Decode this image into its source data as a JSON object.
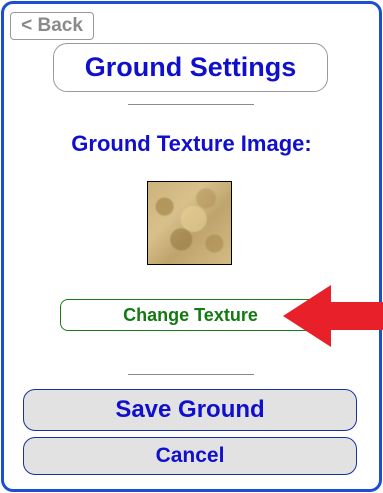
{
  "header": {
    "back_label": "< Back",
    "title": "Ground Settings"
  },
  "texture": {
    "label": "Ground Texture Image:",
    "preview_icon": "sand-texture-image",
    "change_label": "Change Texture"
  },
  "annotation": {
    "arrow_icon": "red-arrow-left-icon",
    "arrow_color": "#e8202a"
  },
  "footer": {
    "save_label": "Save Ground",
    "cancel_label": "Cancel"
  },
  "colors": {
    "panel_border": "#1a4fd0",
    "title_text": "#1010cc",
    "change_text": "#137a13",
    "button_fill": "#e2e2e2"
  }
}
